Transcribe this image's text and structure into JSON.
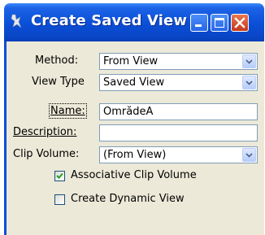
{
  "window": {
    "title": "Create Saved View",
    "icons": {
      "app": "microstation-icon",
      "minimize": "minimize-icon",
      "maximize": "maximize-icon",
      "close": "close-icon"
    },
    "colors": {
      "titlebar": "#0a4fd6",
      "close_button": "#c4381b",
      "dialog_background": "#ece9d8"
    }
  },
  "form": {
    "method": {
      "label": "Method:",
      "value": "From View"
    },
    "view_type": {
      "label": "View Type",
      "value": "Saved View"
    },
    "name": {
      "label": "Name:",
      "value": "OmrådeA"
    },
    "description": {
      "label": "Description:",
      "value": ""
    },
    "clip_volume": {
      "label": "Clip Volume:",
      "value": "(From View)"
    },
    "associative_clip_volume": {
      "label": "Associative Clip Volume",
      "checked": true
    },
    "create_dynamic_view": {
      "label": "Create Dynamic View",
      "checked": false
    }
  }
}
